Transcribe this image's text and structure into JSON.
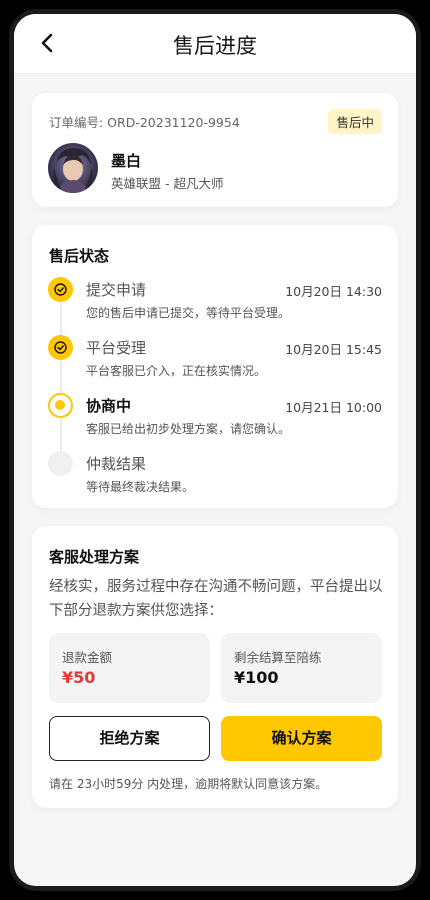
{
  "header": {
    "title": "售后进度"
  },
  "order": {
    "number": "订单编号: ORD-20231120-9954",
    "status_badge": "售后中",
    "player_name": "墨白",
    "player_desc": "英雄联盟 - 超凡大师"
  },
  "status_section": {
    "title": "售后状态",
    "steps": [
      {
        "name": "提交申请",
        "time": "10月20日 14:30",
        "desc": "您的售后申请已提交，等待平台受理。",
        "state": "done"
      },
      {
        "name": "平台受理",
        "time": "10月20日 15:45",
        "desc": "平台客服已介入，正在核实情况。",
        "state": "done"
      },
      {
        "name": "协商中",
        "time": "10月21日 10:00",
        "desc": "客服已给出初步处理方案，请您确认。",
        "state": "current"
      },
      {
        "name": "仲裁结果",
        "time": "",
        "desc": "等待最终裁决结果。",
        "state": "pending"
      }
    ]
  },
  "plan": {
    "title": "客服处理方案",
    "desc": "经核实，服务过程中存在沟通不畅问题，平台提出以下部分退款方案供您选择：",
    "refund_label": "退款金额",
    "refund_value": "¥50",
    "remain_label": "剩余结算至陪练",
    "remain_value": "¥100",
    "reject_label": "拒绝方案",
    "confirm_label": "确认方案",
    "note": "请在 23小时59分 内处理，逾期将默认同意该方案。"
  },
  "colors": {
    "accent": "#ffc700",
    "refund": "#e53935",
    "badge_bg": "#fff4c5"
  },
  "icons": {
    "back": "chevron-left-icon",
    "step_done": "check-circle-icon"
  }
}
